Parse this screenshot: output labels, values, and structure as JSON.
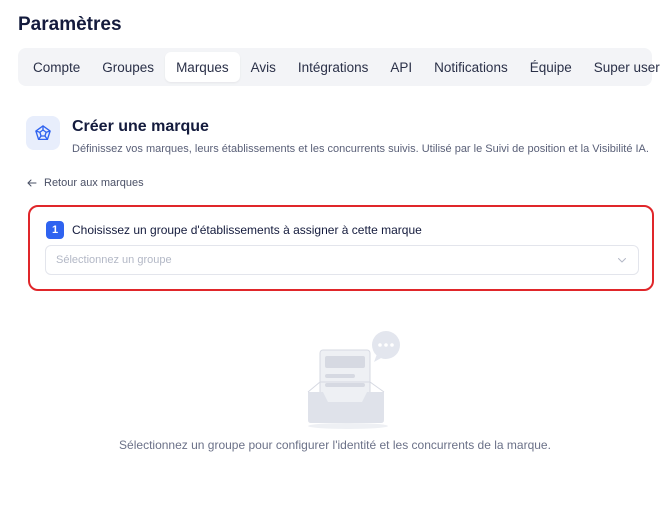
{
  "page": {
    "title": "Paramètres"
  },
  "tabs": [
    {
      "label": "Compte",
      "active": false
    },
    {
      "label": "Groupes",
      "active": false
    },
    {
      "label": "Marques",
      "active": true
    },
    {
      "label": "Avis",
      "active": false
    },
    {
      "label": "Intégrations",
      "active": false
    },
    {
      "label": "API",
      "active": false
    },
    {
      "label": "Notifications",
      "active": false
    },
    {
      "label": "Équipe",
      "active": false
    },
    {
      "label": "Super user",
      "active": false
    }
  ],
  "header": {
    "icon": "brand-badge-icon",
    "title": "Créer une marque",
    "description": "Définissez vos marques, leurs établissements et les concurrents suivis. Utilisé par le Suivi de position et la Visibilité IA."
  },
  "back_link": {
    "icon": "arrow-left-icon",
    "label": "Retour aux marques"
  },
  "step": {
    "number": "1",
    "label": "Choisissez un groupe d'établissements à assigner à cette marque",
    "select_placeholder": "Sélectionnez un groupe"
  },
  "empty_state": {
    "icon": "empty-inbox-icon",
    "text": "Sélectionnez un groupe pour configurer l'identité et les concurrents de la marque."
  },
  "colors": {
    "accent": "#2f63f0",
    "highlight_border": "#e0262a",
    "tab_bar": "#f3f4f7"
  }
}
